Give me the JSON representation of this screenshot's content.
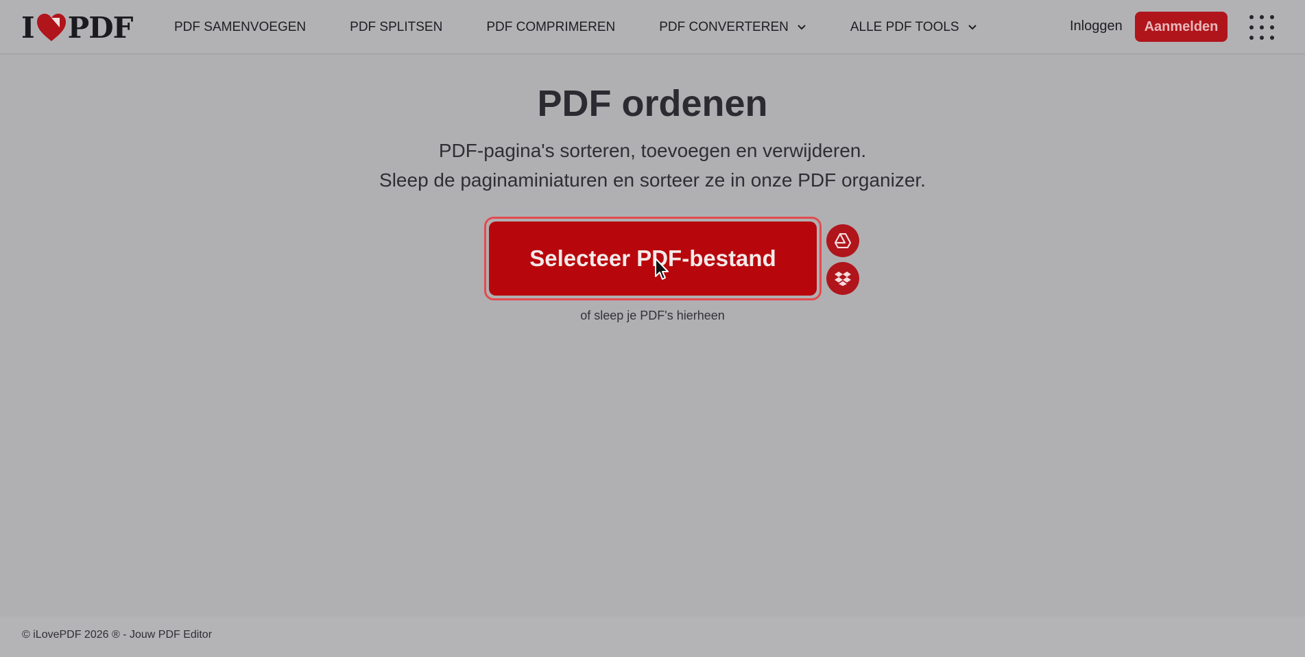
{
  "header": {
    "logo_left": "I",
    "logo_right": "PDF",
    "nav": [
      {
        "label": "PDF SAMENVOEGEN",
        "has_dropdown": false
      },
      {
        "label": "PDF SPLITSEN",
        "has_dropdown": false
      },
      {
        "label": "PDF COMPRIMEREN",
        "has_dropdown": false
      },
      {
        "label": "PDF CONVERTEREN",
        "has_dropdown": true
      },
      {
        "label": "ALLE PDF TOOLS",
        "has_dropdown": true
      }
    ],
    "login_label": "Inloggen",
    "signup_label": "Aanmelden"
  },
  "main": {
    "title": "PDF ordenen",
    "subtitle_line1": "PDF-pagina's sorteren, toevoegen en verwijderen.",
    "subtitle_line2": "Sleep de paginaminiaturen en sorteer ze in onze PDF organizer.",
    "select_button_label": "Selecteer PDF-bestand",
    "drop_hint": "of sleep je PDF's hierheen",
    "cloud_sources": [
      "google-drive-icon",
      "dropbox-icon"
    ]
  },
  "footer": {
    "copyright": "© iLovePDF 2026 ® - Jouw PDF Editor"
  },
  "colors": {
    "brand_red": "#b8070c",
    "overlay_gray": "#b0b0b2",
    "text_dark": "#2b2b31"
  }
}
